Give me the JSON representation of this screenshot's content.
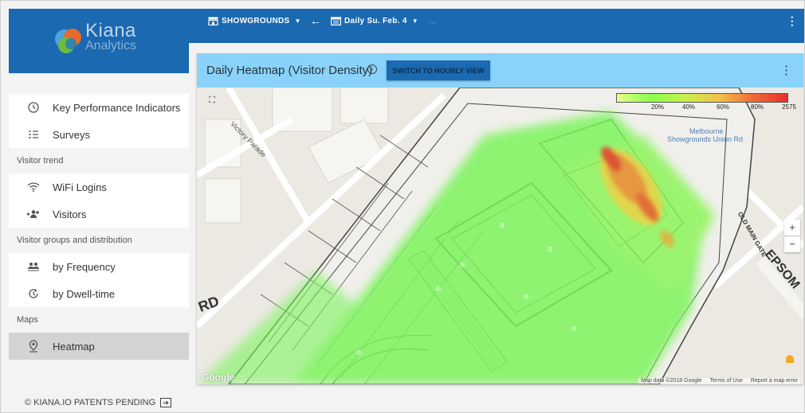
{
  "brand": {
    "name": "Kiana",
    "sub": "Analytics"
  },
  "nav": {
    "kpi": "Key Performance Indicators",
    "surveys": "Surveys",
    "section_visitor_trend": "Visitor trend",
    "wifi": "WiFi Logins",
    "visitors": "Visitors",
    "section_groups": "Visitor groups and distribution",
    "frequency": "by Frequency",
    "dwell": "by Dwell-time",
    "section_maps": "Maps",
    "heatmap": "Heatmap"
  },
  "footer": {
    "text": "© KIANA.IO PATENTS PENDING"
  },
  "topbar": {
    "venue": "SHOWGROUNDS",
    "date": "Daily Su. Feb. 4"
  },
  "panel": {
    "title": "Daily Heatmap (Visitor Density)",
    "switch_label": "SWITCH TO HOURLY VIEW"
  },
  "legend": {
    "ticks": [
      "20%",
      "40%",
      "60%",
      "80%",
      "2575"
    ],
    "max_value": 2575
  },
  "map": {
    "labels": {
      "street": "Victory Parade",
      "poi1": "Melbourne",
      "poi2": "Showgrounds Union Rd",
      "road": "EPSOM",
      "road2": "RD",
      "gate": "OLD MAIN GATE"
    },
    "attribution": [
      "Map data ©2018 Google",
      "Terms of Use",
      "Report a map error"
    ],
    "google_mark": "Google"
  },
  "colors": {
    "primary": "#1a69b1",
    "header": "#89d3fa",
    "active_nav": "#d3d3d3"
  }
}
